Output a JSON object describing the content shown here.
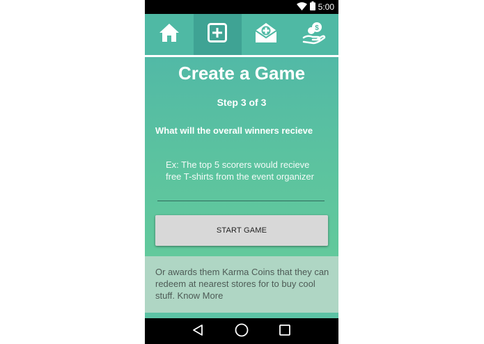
{
  "status_bar": {
    "time": "5:00",
    "icons": [
      "wifi-icon",
      "battery-icon"
    ]
  },
  "top_nav": {
    "items": [
      {
        "name": "home",
        "icon": "home-icon",
        "active": false
      },
      {
        "name": "create-game",
        "icon": "plus-box-icon",
        "active": true
      },
      {
        "name": "invitations",
        "icon": "mail-plus-icon",
        "active": false
      },
      {
        "name": "karma-coins",
        "icon": "coins-hand-icon",
        "active": false
      }
    ]
  },
  "page": {
    "title": "Create a Game",
    "step": "Step 3 of 3",
    "question": "What will the overall winners recieve",
    "reward_field": {
      "value": "",
      "placeholder": "Ex: The top 5 scorers would recieve free T-shirts from the event organizer"
    },
    "start_button": "START GAME"
  },
  "info_panel": {
    "text": "Or awards them Karma Coins that they can redeem at nearest stores for to buy cool stuff. Know More"
  },
  "system_nav": {
    "buttons": [
      "back-icon",
      "home-circle-icon",
      "recents-icon"
    ]
  },
  "colors": {
    "accent": "#5cc3a4",
    "app_bar": "#4fb9a4",
    "active_tab": "#3fa394",
    "button": "#d8d8d8",
    "info_panel": "#afd6c4"
  }
}
